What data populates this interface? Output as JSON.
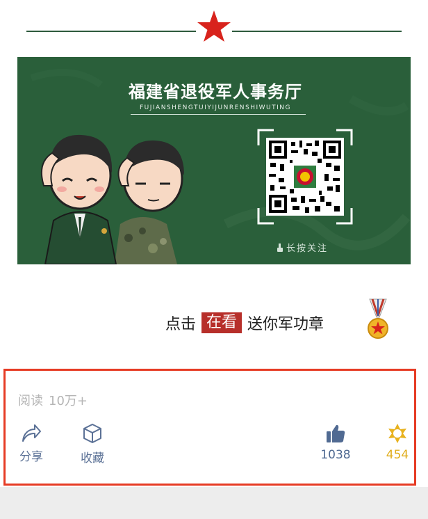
{
  "banner": {
    "title": "福建省退役军人事务厅",
    "subtitle": "FUJIANSHENGTUIYIJUNRENSHIWUTING",
    "longpress_label": "长按关注"
  },
  "cta": {
    "prefix": "点击",
    "highlight": "在看",
    "suffix": "送你军功章"
  },
  "stats": {
    "reads_label": "阅读",
    "reads_value": "10万+"
  },
  "actions": {
    "share_label": "分享",
    "favorite_label": "收藏",
    "like_count": "1038",
    "wow_count": "454"
  },
  "colors": {
    "accent_red": "#e63b24",
    "banner_green": "#2a5f3a",
    "link_blue": "#5b7196",
    "wow_gold": "#e0ad1c"
  },
  "icons": [
    "star-icon",
    "qr-code",
    "share-icon",
    "favorite-icon",
    "like-icon",
    "wow-icon",
    "medal-icon"
  ]
}
